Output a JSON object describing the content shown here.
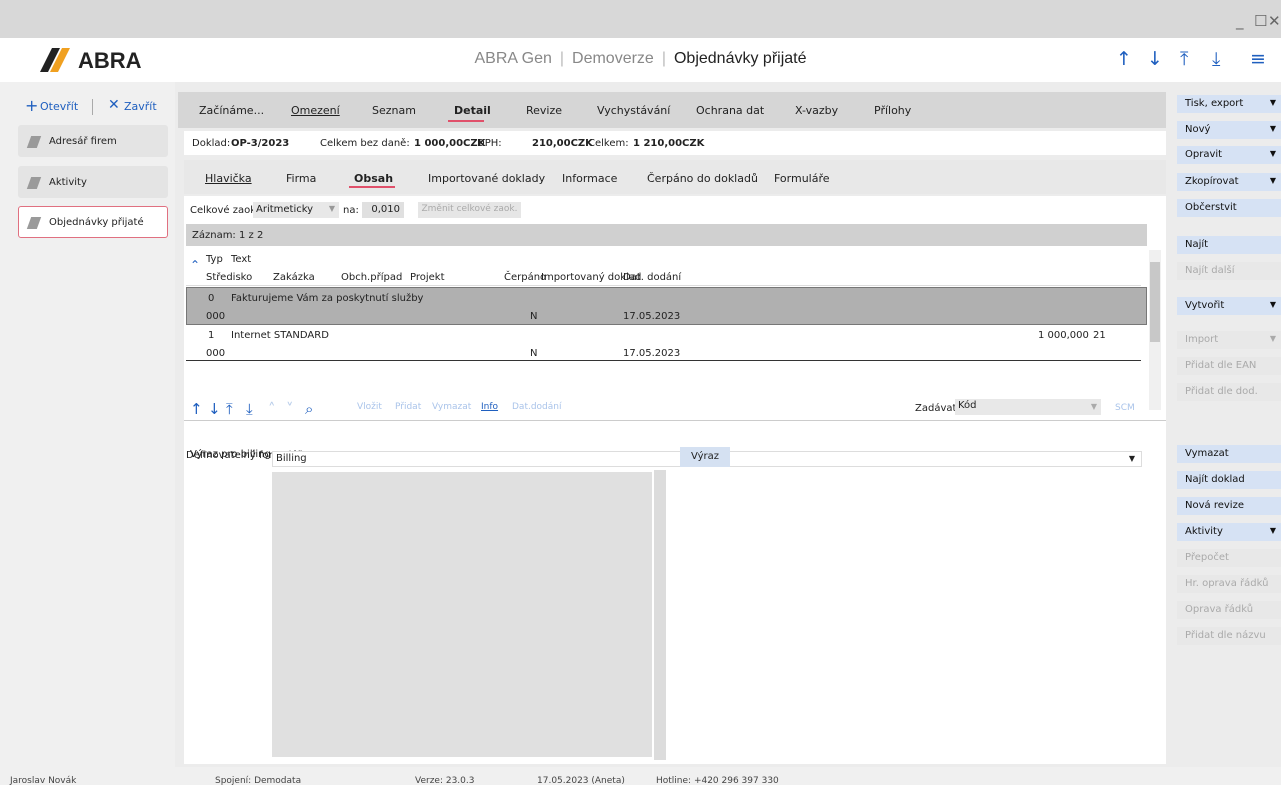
{
  "window": {
    "minimize": "_",
    "maximize": "☐",
    "close": "✕"
  },
  "header": {
    "logo": "ABRA",
    "product": "ABRA Gen",
    "edition": "Demoverze",
    "module": "Objednávky přijaté",
    "nav": [
      "↑",
      "↓",
      "⤒",
      "⤓",
      "≡"
    ]
  },
  "sidebar": {
    "open_label": "Otevřít",
    "close_label": "Zavřít",
    "items": [
      {
        "label": "Adresář firem"
      },
      {
        "label": "Aktivity"
      },
      {
        "label": "Objednávky přijaté"
      }
    ]
  },
  "tabs_main": [
    "Začínáme...",
    "Omezení",
    "Seznam",
    "Detail",
    "Revize",
    "Vychystávání",
    "Ochrana dat",
    "X-vazby",
    "Přílohy"
  ],
  "doc": {
    "doklad_label": "Doklad:",
    "doklad": "OP-3/2023",
    "bez_dane_label": "Celkem bez daně:",
    "bez_dane": "1 000,00CZK",
    "dph_label": "DPH:",
    "dph": "210,00CZK",
    "celkem_label": "Celkem:",
    "celkem": "1 210,00CZK"
  },
  "tabs_sub": [
    "Hlavička",
    "Firma",
    "Obsah",
    "Importované doklady",
    "Informace",
    "Čerpáno do dokladů",
    "Formuláře"
  ],
  "rounding": {
    "label": "Celkové zaok.:",
    "method": "Aritmeticky",
    "na_label": "na:",
    "na": "0,010",
    "button": "Změnit celkové zaok."
  },
  "zaznam": "Záznam: 1 z 2",
  "grid": {
    "header_row1": [
      "Typ",
      "Text"
    ],
    "header_row2": [
      "Středisko",
      "Zakázka",
      "Obch.případ",
      "Projekt",
      "Čerpáno",
      "Importovaný doklad",
      "Dat. dodání"
    ],
    "rows": [
      {
        "typ": "0",
        "text": "Fakturujeme Vám za poskytnutí služby",
        "stredisko": "000",
        "cerpano": "N",
        "datum": "17.05.2023",
        "qty": "",
        "dph": ""
      },
      {
        "typ": "1",
        "text": "Internet STANDARD",
        "stredisko": "000",
        "cerpano": "N",
        "datum": "17.05.2023",
        "qty": "1 000,000",
        "dph": "21"
      }
    ]
  },
  "nav_actions": [
    "Vložit",
    "Přidat",
    "Vymazat",
    "Info",
    "Dat.dodání"
  ],
  "zadavat": {
    "label": "Zadávat:",
    "value": "Kód",
    "scm": "SCM"
  },
  "form": {
    "def_label": "Definovatelný formulář:",
    "def_value": "Billing",
    "expr_label": "Výraz pro billing",
    "expr_button": "Výraz"
  },
  "right_buttons": [
    {
      "label": "Tisk, export",
      "dd": "▼",
      "disabled": false
    },
    {
      "label": "Nový",
      "dd": "▼",
      "disabled": false
    },
    {
      "label": "Opravit",
      "dd": "▼",
      "disabled": false
    },
    {
      "label": "Zkopírovat",
      "dd": "▼",
      "disabled": false
    },
    {
      "label": "Občerstvit",
      "dd": "",
      "disabled": false
    },
    {
      "label": "Najít",
      "dd": "",
      "disabled": false
    },
    {
      "label": "Najít další",
      "dd": "",
      "disabled": true
    },
    {
      "label": "Vytvořit",
      "dd": "▼",
      "disabled": false
    },
    {
      "label": "Import",
      "dd": "▼",
      "disabled": true
    },
    {
      "label": "Přidat dle EAN",
      "dd": "",
      "disabled": true
    },
    {
      "label": "Přidat dle dod.",
      "dd": "",
      "disabled": true
    },
    {
      "label": "Vymazat",
      "dd": "",
      "disabled": false
    },
    {
      "label": "Najít doklad",
      "dd": "",
      "disabled": false
    },
    {
      "label": "Nová revize",
      "dd": "",
      "disabled": false
    },
    {
      "label": "Aktivity",
      "dd": "▼",
      "disabled": false
    },
    {
      "label": "Přepočet",
      "dd": "",
      "disabled": true
    },
    {
      "label": "Hr. oprava řádků",
      "dd": "",
      "disabled": true
    },
    {
      "label": "Oprava řádků",
      "dd": "",
      "disabled": true
    },
    {
      "label": "Přidat dle názvu",
      "dd": "",
      "disabled": true
    }
  ],
  "status": {
    "user": "Jaroslav Novák",
    "connection": "Spojení: Demodata",
    "version": "Verze: 23.0.3",
    "date": "17.05.2023 (Aneta)",
    "hotline": "Hotline: +420 296 397 330"
  }
}
